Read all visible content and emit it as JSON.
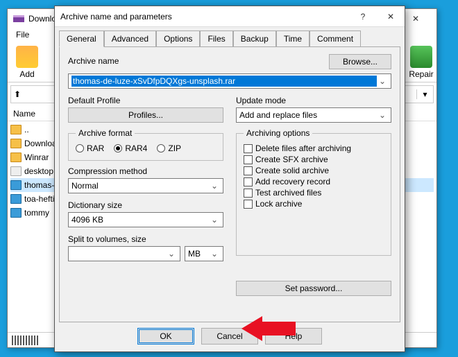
{
  "bg": {
    "title": "Downloads",
    "menu": [
      "File"
    ],
    "toolbar": {
      "add": "Add",
      "repair": "Repair"
    },
    "list_header": "Name",
    "rows": [
      "..",
      "Downloads",
      "Winrar",
      "desktop.ini",
      "thomas-de-luze",
      "toa-heftiba",
      "tommy"
    ]
  },
  "dialog": {
    "title": "Archive name and parameters",
    "tabs": [
      "General",
      "Advanced",
      "Options",
      "Files",
      "Backup",
      "Time",
      "Comment"
    ],
    "browse": "Browse...",
    "archive_name_label": "Archive name",
    "archive_name_value": "thomas-de-luze-xSvDfpDQXgs-unsplash.rar",
    "default_profile_label": "Default Profile",
    "profiles_btn": "Profiles...",
    "update_mode_label": "Update mode",
    "update_mode_value": "Add and replace files",
    "archive_format_legend": "Archive format",
    "formats": {
      "rar": "RAR",
      "rar4": "RAR4",
      "zip": "ZIP"
    },
    "compression_label": "Compression method",
    "compression_value": "Normal",
    "dict_label": "Dictionary size",
    "dict_value": "4096 KB",
    "split_label": "Split to volumes, size",
    "split_unit": "MB",
    "options_legend": "Archiving options",
    "options": [
      "Delete files after archiving",
      "Create SFX archive",
      "Create solid archive",
      "Add recovery record",
      "Test archived files",
      "Lock archive"
    ],
    "set_password": "Set password...",
    "ok": "OK",
    "cancel": "Cancel",
    "help": "Help"
  }
}
